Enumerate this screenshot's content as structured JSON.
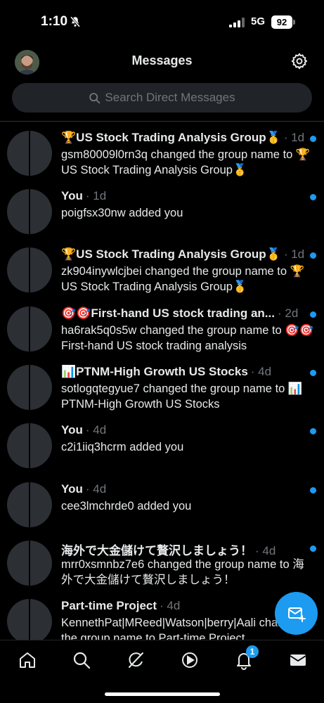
{
  "status_bar": {
    "time": "1:10",
    "network": "5G",
    "battery": "92"
  },
  "header": {
    "title": "Messages"
  },
  "search": {
    "placeholder": "Search Direct Messages"
  },
  "conversations": [
    {
      "title": "🏆US Stock Trading Analysis Group🥇",
      "meta": "· 1d",
      "preview": "gsm80009l0rn3q changed the group name to 🏆US Stock Trading Analysis Group🥇",
      "unread": true
    },
    {
      "title": "You",
      "meta": "· 1d",
      "preview": "poigfsx30nw added you",
      "unread": true
    },
    {
      "title": "🏆US Stock Trading Analysis Group🥇",
      "meta": "· 1d",
      "preview": "zk904inywlcjbei changed the group name to 🏆US Stock Trading Analysis Group🥇",
      "unread": true
    },
    {
      "title": "🎯🎯First-hand US stock trading an...",
      "meta": "· 2d",
      "preview": "ha6rak5q0s5w changed the group name to 🎯🎯First-hand US stock trading analysis",
      "unread": true
    },
    {
      "title": "📊PTNM-High Growth US Stocks",
      "meta": "· 4d",
      "preview": "sotlogqtegyue7 changed the group name to 📊PTNM-High Growth US Stocks",
      "unread": true
    },
    {
      "title": "You",
      "meta": "· 4d",
      "preview": "c2i1iiq3hcrm added you",
      "unread": true
    },
    {
      "title": "You",
      "meta": "· 4d",
      "preview": "cee3lmchrde0 added you",
      "unread": true
    },
    {
      "title": "海外で大金儲けて贅沢しましょう！",
      "meta": "· 4d",
      "preview": "mrr0xsmnbz7e6 changed the group name to 海外で大金儲けて贅沢しましょう！",
      "unread": true
    },
    {
      "title": "Part-time Project",
      "meta": "· 4d",
      "preview": "KennethPat|MReed|Watson|berry|Aali changed the group name to Part-time Project",
      "unread": false
    }
  ],
  "tab_bar": {
    "notifications_badge": "1"
  },
  "colors": {
    "accent": "#1d9bf0",
    "background": "#000000",
    "muted_text": "#71767b"
  },
  "icons": [
    "bell-off-icon",
    "signal-icon",
    "gear-icon",
    "search-icon",
    "home-icon",
    "explore-icon",
    "grok-icon",
    "video-icon",
    "notifications-icon",
    "mail-icon",
    "compose-message-icon"
  ]
}
